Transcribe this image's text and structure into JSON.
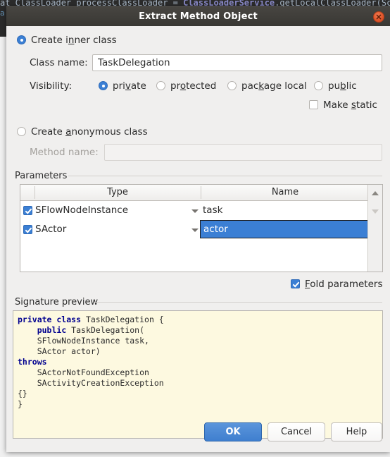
{
  "background": {
    "code_prefix": "at ClassLoader processClassLoader = ",
    "code_class": "ClassLoaderService",
    "code_suffix": ".getLocalClassLoader(Scop",
    "sliver": "a"
  },
  "titlebar": {
    "title": "Extract Method Object",
    "close_icon": "close-icon"
  },
  "inner_class": {
    "radio_label_pre": "Create i",
    "radio_label_mnemonic": "n",
    "radio_label_post": "ner class",
    "selected": true,
    "class_name_label": "Class name:",
    "class_name_value": "TaskDelegation"
  },
  "visibility": {
    "label": "Visibility:",
    "options": [
      {
        "pre": "pri",
        "mn": "v",
        "post": "ate",
        "selected": true
      },
      {
        "pre": "pr",
        "mn": "o",
        "post": "tected",
        "selected": false
      },
      {
        "pre": "pac",
        "mn": "k",
        "post": "age local",
        "selected": false
      },
      {
        "pre": "pu",
        "mn": "b",
        "post": "lic",
        "selected": false
      }
    ],
    "make_static": {
      "pre": "Make ",
      "mn": "s",
      "post": "tatic",
      "checked": false
    }
  },
  "anonymous_class": {
    "radio_label_pre": "Create ",
    "radio_label_mnemonic": "a",
    "radio_label_post": "nonymous class",
    "selected": false,
    "method_name_label": "Method name:",
    "method_name_value": "",
    "disabled": true
  },
  "parameters": {
    "group_title": "Parameters",
    "columns": [
      "",
      "Type",
      "Name"
    ],
    "rows": [
      {
        "checked": true,
        "type": "SFlowNodeInstance",
        "name": "task",
        "selected": false
      },
      {
        "checked": true,
        "type": "SActor",
        "name": "actor",
        "selected": true
      }
    ],
    "scroll_up_icon": "scroll-up-icon",
    "scroll_down_icon": "scroll-down-icon",
    "fold": {
      "pre": "",
      "mn": "F",
      "post": "old parameters",
      "checked": true
    }
  },
  "signature": {
    "group_title": "Signature preview",
    "lines": [
      [
        {
          "t": "private class",
          "k": true
        },
        {
          "t": " TaskDelegation {",
          "k": false
        }
      ],
      [
        {
          "t": "    ",
          "k": false
        },
        {
          "t": "public",
          "k": true
        },
        {
          "t": " TaskDelegation(",
          "k": false
        }
      ],
      [
        {
          "t": "    SFlowNodeInstance task,",
          "k": false
        }
      ],
      [
        {
          "t": "    SActor actor)",
          "k": false
        }
      ],
      [
        {
          "t": "throws",
          "k": true
        }
      ],
      [
        {
          "t": "    SActorNotFoundException",
          "k": false
        }
      ],
      [
        {
          "t": "    SActivityCreationException",
          "k": false
        }
      ],
      [
        {
          "t": "{}",
          "k": false
        }
      ],
      [
        {
          "t": "}",
          "k": false
        }
      ]
    ]
  },
  "buttons": {
    "ok": "OK",
    "cancel": "Cancel",
    "help": "Help"
  },
  "colors": {
    "accent": "#3b7fd4",
    "titlebar": "#3c3b37",
    "close": "#e2562b",
    "preview_bg": "#fdf9e0",
    "keyword": "#00008f"
  }
}
